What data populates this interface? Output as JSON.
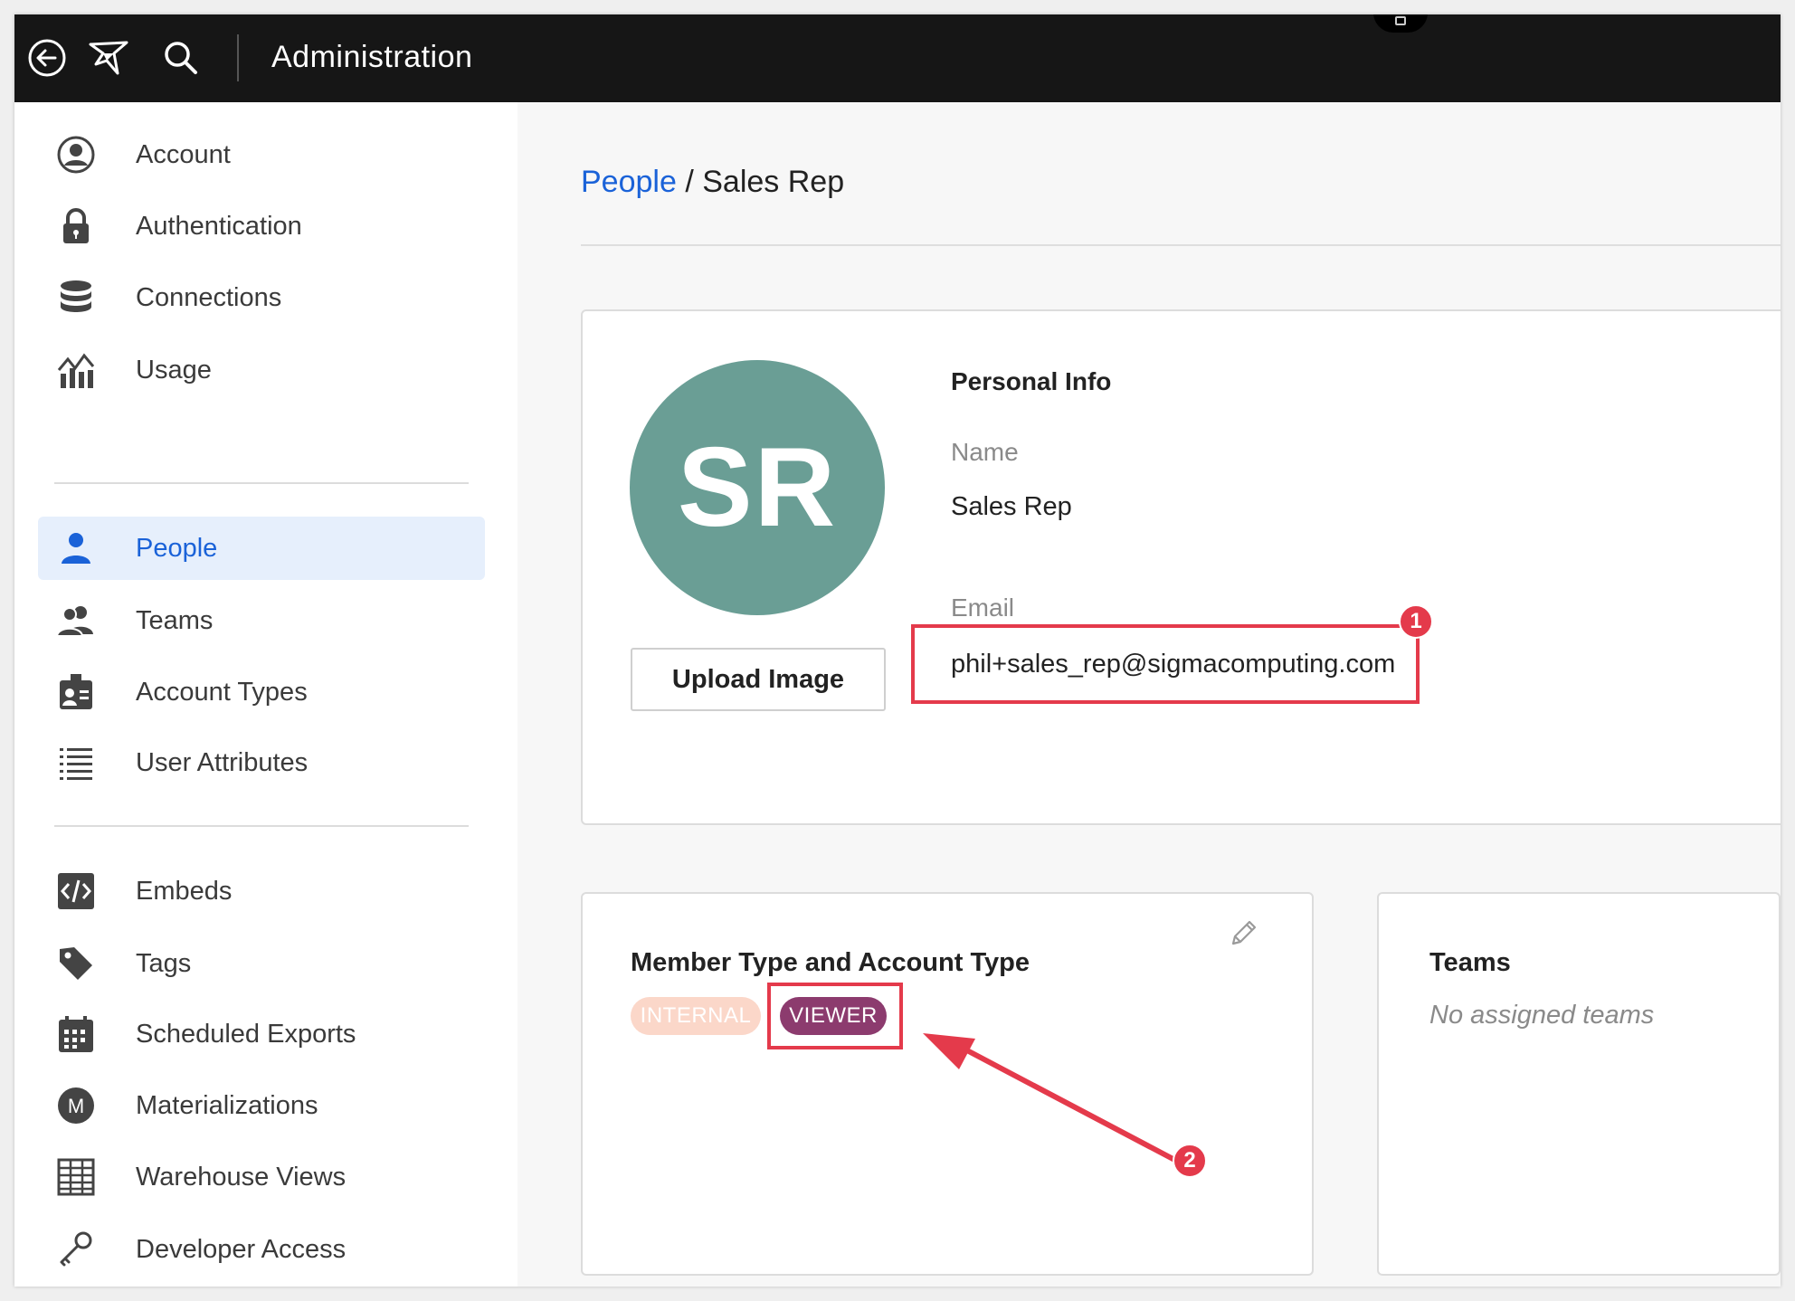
{
  "header": {
    "title": "Administration",
    "icons": [
      "back-arrow-icon",
      "logo-icon",
      "search-icon"
    ]
  },
  "sidebar": {
    "groups": [
      [
        {
          "label": "Account",
          "icon": "user-circle-icon"
        },
        {
          "label": "Authentication",
          "icon": "lock-icon"
        },
        {
          "label": "Connections",
          "icon": "database-icon"
        },
        {
          "label": "Usage",
          "icon": "usage-chart-icon"
        }
      ],
      [
        {
          "label": "People",
          "icon": "person-icon",
          "active": true
        },
        {
          "label": "Teams",
          "icon": "team-icon"
        },
        {
          "label": "Account Types",
          "icon": "id-badge-icon"
        },
        {
          "label": "User Attributes",
          "icon": "list-icon"
        }
      ],
      [
        {
          "label": "Embeds",
          "icon": "code-icon"
        },
        {
          "label": "Tags",
          "icon": "tag-icon"
        },
        {
          "label": "Scheduled Exports",
          "icon": "calendar-icon"
        },
        {
          "label": "Materializations",
          "icon": "m-circle-icon"
        },
        {
          "label": "Warehouse Views",
          "icon": "table-grid-icon"
        },
        {
          "label": "Developer Access",
          "icon": "key-icon"
        }
      ]
    ],
    "accent_color": "#1a62d8",
    "active_bg": "#e6effc"
  },
  "breadcrumb": {
    "link": "People",
    "separator": "/",
    "current": "Sales Rep"
  },
  "profile": {
    "initials": "SR",
    "avatar_color": "#6a9e95",
    "upload_label": "Upload Image",
    "section_title": "Personal Info",
    "name_label": "Name",
    "name_value": "Sales Rep",
    "email_label": "Email",
    "email_value": "phil+sales_rep@sigmacomputing.com"
  },
  "member": {
    "title": "Member Type and Account Type",
    "member_type": "INTERNAL",
    "account_type": "VIEWER",
    "viewer_color": "#8c3b6e",
    "internal_color": "#fbd7c9"
  },
  "teams": {
    "title": "Teams",
    "empty_text": "No assigned teams"
  },
  "annotations": {
    "marker_1": "1",
    "marker_2": "2",
    "color": "#e43a4b"
  }
}
